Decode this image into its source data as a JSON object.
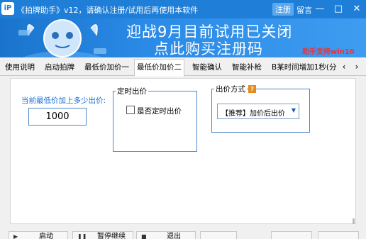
{
  "titlebar": {
    "app_icon": "iP",
    "title": "《拍牌助手》v12，请确认注册/试用后再使用本软件",
    "register_label": "注册",
    "message_label": "留言",
    "minimize_icon": "minimize-icon",
    "maximize_icon": "maximize-icon",
    "close_icon": "close-icon"
  },
  "banner": {
    "line1": "迎战9月目前试用已关闭",
    "line2": "点此购买注册码",
    "win10_note": "助手支持win10"
  },
  "tabs": [
    {
      "label": "使用说明"
    },
    {
      "label": "启动拍牌"
    },
    {
      "label": "最低价加价一"
    },
    {
      "label": "最低价加价二"
    },
    {
      "label": "智能确认"
    },
    {
      "label": "智能补枪"
    },
    {
      "label": "B某时间增加1秒(分"
    }
  ],
  "active_tab": "最低价加价二",
  "main": {
    "price_label": "当前最低价加上多少出价:",
    "price_value": "1000",
    "timed_group": {
      "title": "定时出价",
      "checkbox_label": "是否定时出价",
      "checked": false
    },
    "bid_group": {
      "title": "出价方式",
      "help_icon": "help-icon",
      "selected_option": "【推荐】加价后出价"
    }
  },
  "bottom_buttons": [
    {
      "label": "启动",
      "icon": "play-icon"
    },
    {
      "label": "暂停继续",
      "icon": "pause-icon"
    },
    {
      "label": "退出",
      "icon": "stop-icon"
    }
  ],
  "colors": {
    "titlebar": "#1f7fd8",
    "banner": "#2a8ae6",
    "accent_text": "#1a6fd6",
    "promo_red": "#ff2a2a"
  }
}
